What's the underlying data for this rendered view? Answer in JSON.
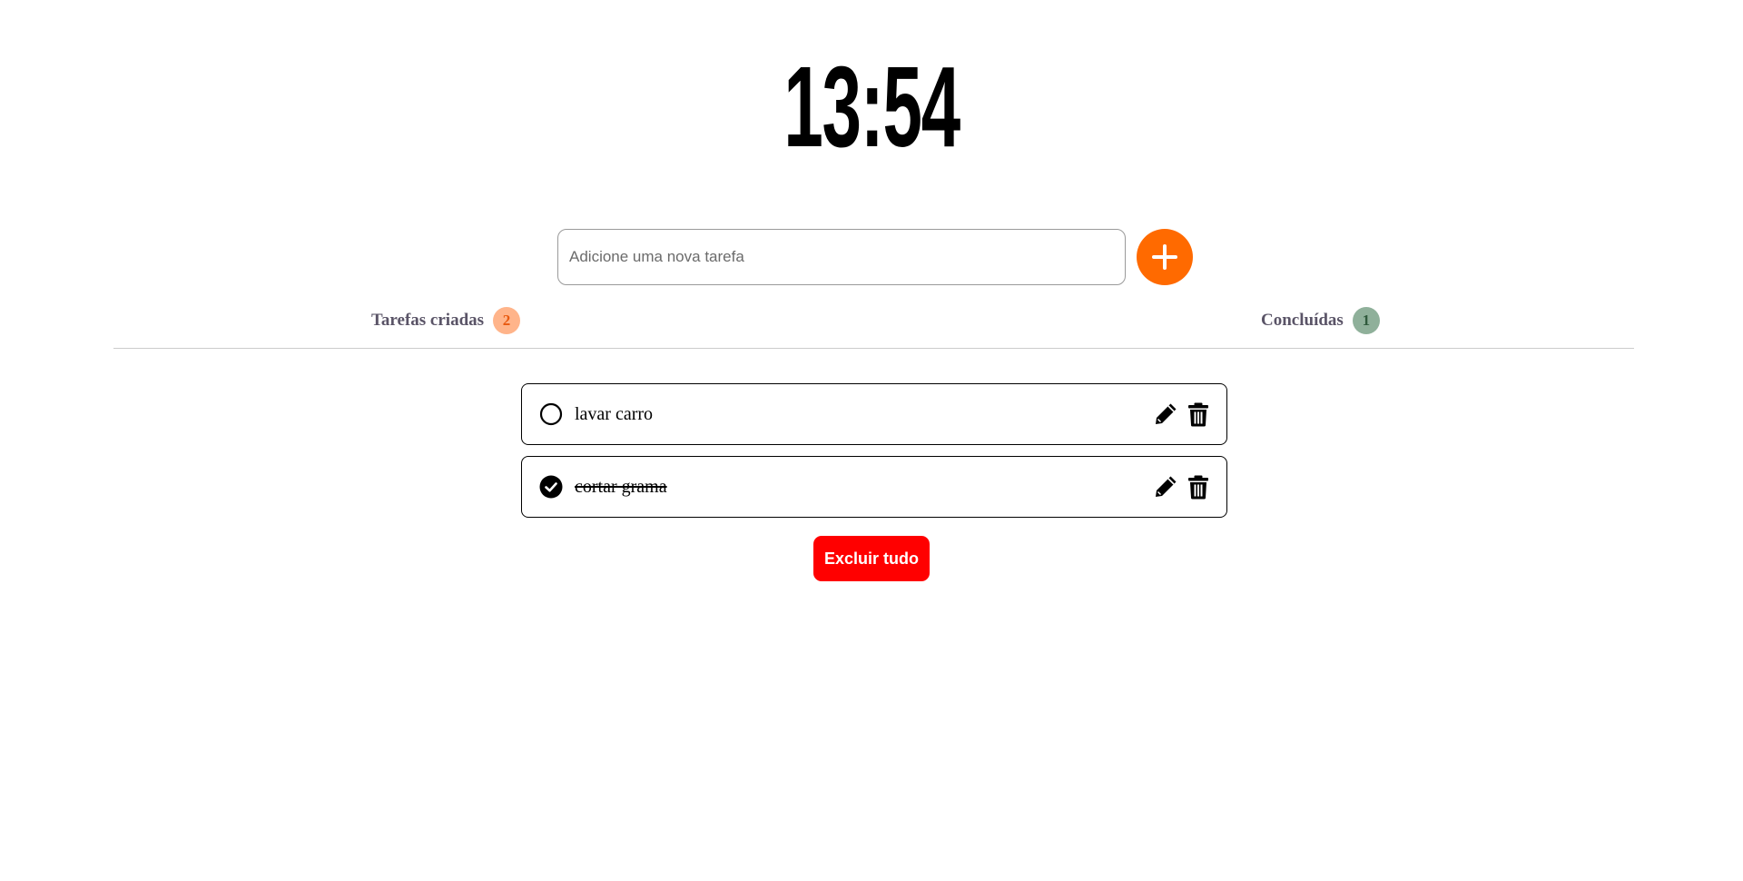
{
  "clock": {
    "time": "13:54"
  },
  "new_task": {
    "placeholder": "Adicione uma nova tarefa",
    "value": "",
    "add_icon": "plus-icon"
  },
  "counters": {
    "created_label": "Tarefas criadas",
    "created_count": "2",
    "done_label": "Concluídas",
    "done_count": "1"
  },
  "tasks": [
    {
      "text": "lavar carro",
      "completed": false,
      "edit_icon": "pencil-icon",
      "delete_icon": "trash-icon"
    },
    {
      "text": "cortar grama",
      "completed": true,
      "edit_icon": "pencil-icon",
      "delete_icon": "trash-icon"
    }
  ],
  "actions": {
    "clear_all_label": "Excluir tudo"
  },
  "colors": {
    "accent": "#ff6a00",
    "created_badge_bg": "#ffb48a",
    "created_badge_text": "#e85a10",
    "done_badge_bg": "#8fb09a",
    "done_badge_text": "#2f5a3c",
    "danger": "#ff0000"
  }
}
